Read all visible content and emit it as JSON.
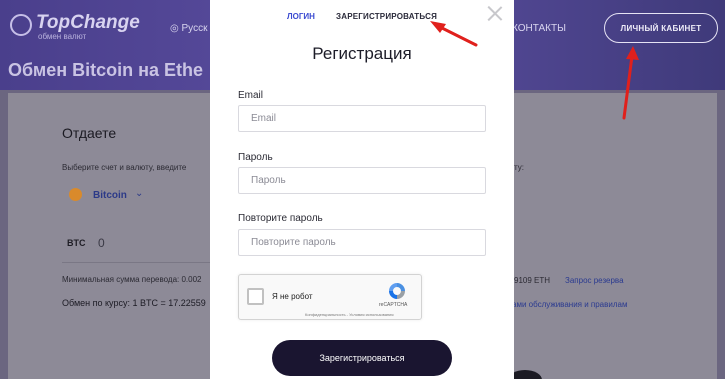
{
  "site": {
    "logo": "TopChange",
    "logo_sub": "обмен валют",
    "language": "Русск",
    "nav_contacts": "КОНТАКТЫ",
    "cabinet_button": "ЛИЧНЫЙ КАБИНЕТ",
    "page_title": "Обмен Bitcoin на Ethe"
  },
  "panel": {
    "heading": "Отдаете",
    "choose_text": "Выберите счет и валюту, введите",
    "choose_text_right": "ту:",
    "coin_name": "Bitcoin",
    "coin_code": "BTC",
    "amount": "0",
    "min_amount": "Минимальная сумма перевода: 0.002",
    "reserve_text": "9109 ETH",
    "reserve_link": "Запрос резерва",
    "rate_text": "Обмен по курсу: 1 BTC = 17.22559",
    "rules_link": "ами обслуживания и правилам"
  },
  "modal": {
    "tab_login": "ЛОГИН",
    "tab_register": "ЗАРЕГИСТРИРОВАТЬСЯ",
    "title": "Регистрация",
    "email_label": "Email",
    "email_placeholder": "Email",
    "password_label": "Пароль",
    "password_placeholder": "Пароль",
    "repeat_label": "Повторите пароль",
    "repeat_placeholder": "Повторите пароль",
    "captcha_text": "Я не робот",
    "captcha_brand": "reCAPTCHA",
    "captcha_privacy": "Конфиденциальность - Условия использования",
    "submit_label": "Зарегистрироваться"
  },
  "colors": {
    "header_bg": "#4a3f8c",
    "accent_link": "#3b4bd1",
    "submit_bg": "#1a1530",
    "annotation_arrow": "#e0201c"
  }
}
